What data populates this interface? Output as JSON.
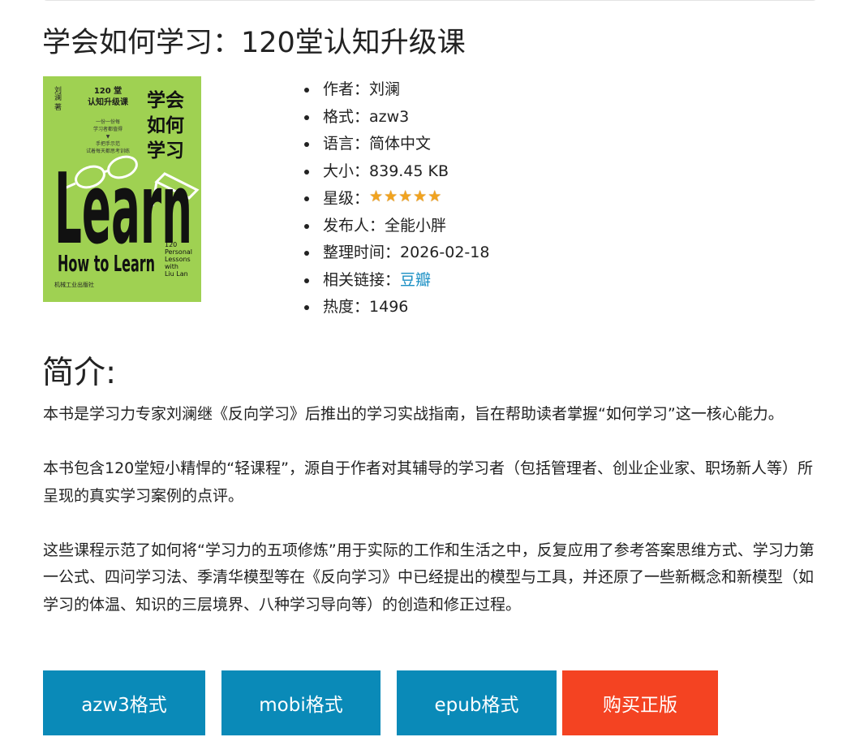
{
  "book": {
    "title": "学会如何学习：120堂认知升级课"
  },
  "cover": {
    "author": "刘澜 著",
    "subtitle": "120 堂\n认知升级课",
    "tagline": "一份一份每\n学习者都值得\n▼\n手把手示范\n试着每天都思考训练",
    "title_cn": "学会\n如何\n学习",
    "big_word": "Learn",
    "en_title": "How to Learn",
    "en_side": "120\nPersonal\nLessons\nwith\nLiu Lan",
    "publisher": "机械工业出版社",
    "background_color": "#9fd152"
  },
  "info": {
    "author_label": "作者：",
    "author": "刘澜",
    "format_label": "格式：",
    "format": "azw3",
    "language_label": "语言：",
    "language": "简体中文",
    "size_label": "大小：",
    "size": "839.45 KB",
    "rating_label": "星级：",
    "rating": 5,
    "rating_max": 5,
    "publisher_label": "发布人：",
    "publisher": "全能小胖",
    "date_label": "整理时间：",
    "date": "2026-02-18",
    "link_label": "相关链接：",
    "link": "豆瓣",
    "heat_label": "热度：",
    "heat": "1496"
  },
  "intro": {
    "heading": "简介:",
    "paragraphs": [
      "本书是学习力专家刘澜继《反向学习》后推出的学习实战指南，旨在帮助读者掌握“如何学习”这一核心能力。",
      "本书包含120堂短小精悍的“轻课程”，源自于作者对其辅导的学习者（包括管理者、创业企业家、职场新人等）所呈现的真实学习案例的点评。",
      "这些课程示范了如何将“学习力的五项修炼”用于实际的工作和生活之中，反复应用了参考答案思维方式、学习力第一公式、四问学习法、季清华模型等在《反向学习》中已经提出的模型与工具，并还原了一些新概念和新模型（如学习的体温、知识的三层境界、八种学习导向等）的创造和修正过程。"
    ]
  },
  "buttons": {
    "azw3": "azw3格式",
    "mobi": "mobi格式",
    "epub": "epub格式",
    "buy": "购买正版"
  },
  "colors": {
    "download_button": "#0a8ab8",
    "buy_button": "#f44322",
    "link": "#1a8fc4",
    "star": "#f1a31f"
  }
}
